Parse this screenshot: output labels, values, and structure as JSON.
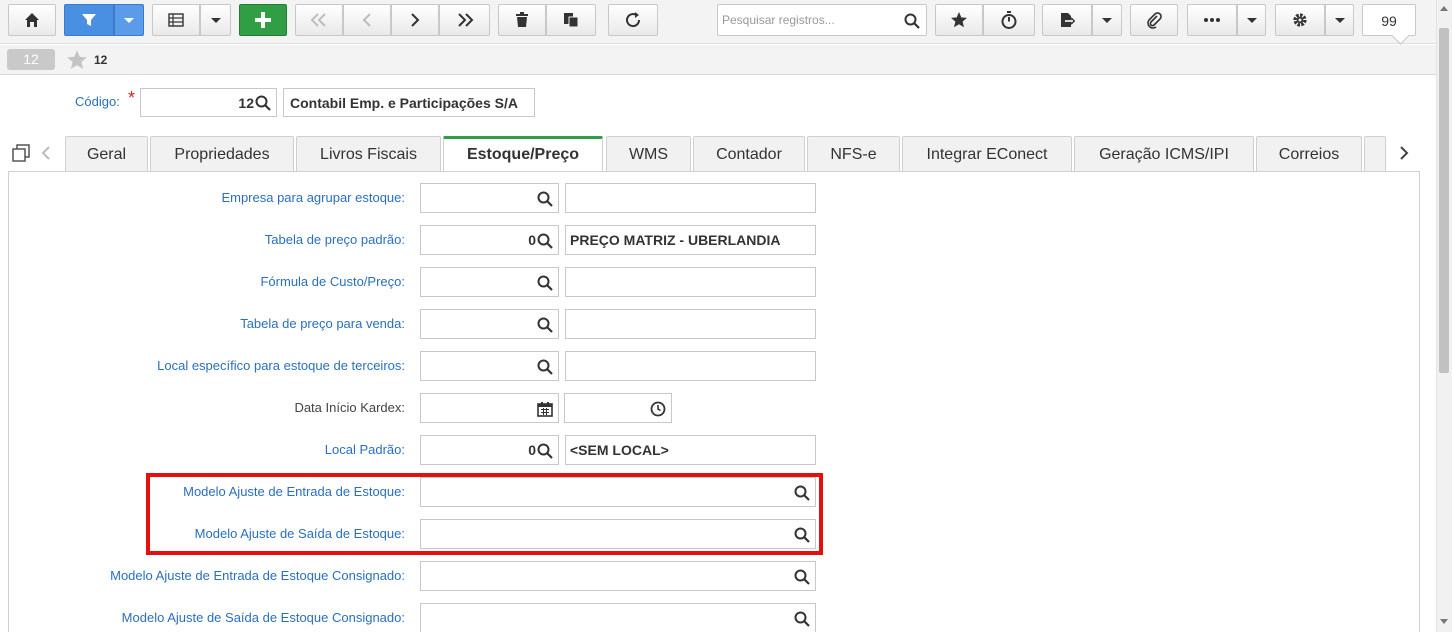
{
  "toolbar": {
    "search_placeholder": "Pesquisar registros...",
    "page_count": "99",
    "icons": [
      "home-icon",
      "filter-icon",
      "grid-icon",
      "plus-icon",
      "first-icon",
      "prev-icon",
      "next-icon",
      "last-icon",
      "trash-icon",
      "copy-icon",
      "refresh-icon",
      "search-icon",
      "star-icon",
      "stopwatch-icon",
      "export-icon",
      "paperclip-icon",
      "more-icon",
      "gear-icon"
    ]
  },
  "record": {
    "badge": "12",
    "label": "12"
  },
  "header": {
    "codigo_label": "Código:",
    "required_mark": "*",
    "codigo_value": "12",
    "empresa_value": "Contabil Emp. e Participações S/A"
  },
  "tabs": [
    {
      "label": "Geral"
    },
    {
      "label": "Propriedades"
    },
    {
      "label": "Livros Fiscais"
    },
    {
      "label": "Estoque/Preço",
      "active": true
    },
    {
      "label": "WMS"
    },
    {
      "label": "Contador"
    },
    {
      "label": "NFS-e"
    },
    {
      "label": "Integrar EConect"
    },
    {
      "label": "Geração ICMS/IPI"
    },
    {
      "label": "Correios"
    }
  ],
  "fields": {
    "empresa_agrupar": {
      "label": "Empresa para agrupar estoque:",
      "value": "",
      "desc": ""
    },
    "tabela_preco_padrao": {
      "label": "Tabela de preço padrão:",
      "value": "0",
      "desc": "PREÇO MATRIZ - UBERLANDIA"
    },
    "formula_custo": {
      "label": "Fórmula de Custo/Preço:",
      "value": "",
      "desc": ""
    },
    "tabela_preco_venda": {
      "label": "Tabela de preço para venda:",
      "value": "",
      "desc": ""
    },
    "local_terceiros": {
      "label": "Local específico para estoque de terceiros:",
      "value": "",
      "desc": ""
    },
    "data_inicio_kardex": {
      "label": "Data Início Kardex:",
      "date": "",
      "time": ""
    },
    "local_padrao": {
      "label": "Local Padrão:",
      "value": "0",
      "desc": "<SEM LOCAL>"
    },
    "modelo_entrada": {
      "label": "Modelo Ajuste de Entrada de Estoque:",
      "value": ""
    },
    "modelo_saida": {
      "label": "Modelo Ajuste de Saída de Estoque:",
      "value": ""
    },
    "modelo_entrada_consig": {
      "label": "Modelo Ajuste de Entrada de Estoque Consignado:",
      "value": ""
    },
    "modelo_saida_consig": {
      "label": "Modelo Ajuste de Saída de Estoque Consignado:",
      "value": ""
    }
  },
  "colors": {
    "accent_blue": "#4a90e2",
    "add_green": "#2f9e44",
    "label_blue": "#2a6fbf",
    "highlight_red": "#e41010"
  }
}
